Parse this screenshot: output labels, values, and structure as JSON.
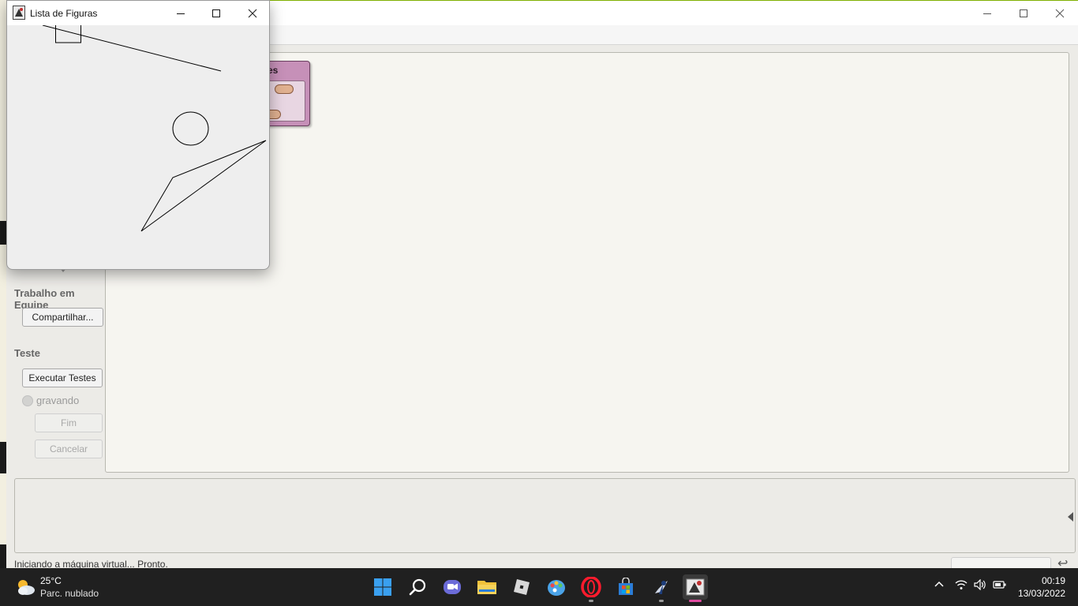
{
  "figures_window": {
    "title": "Lista de Figuras",
    "controls": {
      "minimize": "minimize-icon",
      "maximize": "maximize-icon",
      "close": "close-icon"
    }
  },
  "main_window": {
    "controls": {
      "minimize": "minimize-icon",
      "maximize": "maximize-icon",
      "close": "close-icon"
    },
    "class_box_label": "es"
  },
  "side_panel": {
    "team_title": "Trabalho em Equipe",
    "share_button": "Compartilhar...",
    "test_title": "Teste",
    "run_tests_button": "Executar Testes",
    "recording_label": "gravando",
    "end_button": "Fim",
    "cancel_button": "Cancelar"
  },
  "status_bar": {
    "message": "Iniciando a máquina virtual... Pronto."
  },
  "taskbar": {
    "weather": {
      "temperature": "25°C",
      "description": "Parc. nublado"
    },
    "apps": [
      "windows-start-icon",
      "search-icon",
      "teams-chat-icon",
      "file-explorer-icon",
      "roblox-icon",
      "paint-icon",
      "opera-icon",
      "microsoft-store-icon",
      "bluej-icon",
      "java-app-icon"
    ],
    "clock": {
      "time": "00:19",
      "date": "13/03/2022"
    }
  },
  "colors": {
    "class_box": "#c690b8",
    "canvas_background": "#f6f5f0",
    "taskbar": "#202020",
    "active_indicator": "#e04ba0"
  }
}
